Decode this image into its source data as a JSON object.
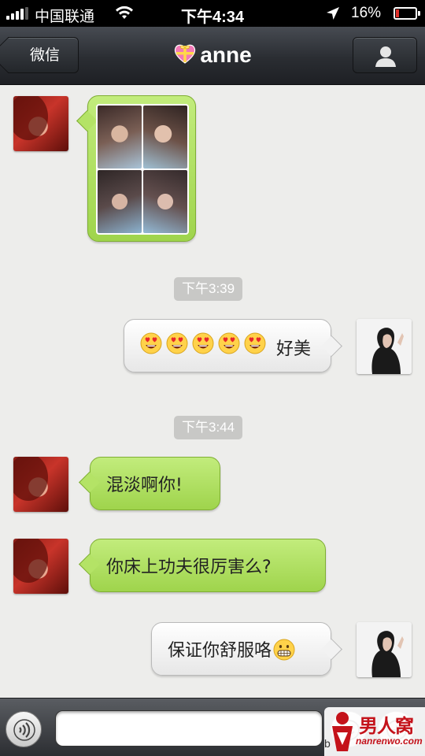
{
  "status_bar": {
    "carrier": "中国联通",
    "time": "下午4:34",
    "battery": "16%",
    "battery_level": 0.16,
    "icons": [
      "signal-icon",
      "wifi-icon",
      "location-arrow-icon",
      "battery-icon"
    ]
  },
  "nav": {
    "back_label": "微信",
    "title": "anne",
    "title_icon": "gift-heart-icon",
    "contact_icon": "person-icon"
  },
  "messages": [
    {
      "from": "them",
      "type": "image",
      "content": "photo-collage"
    },
    {
      "type": "timestamp",
      "text": "下午3:39"
    },
    {
      "from": "me",
      "type": "text",
      "emoji": [
        "heart-eyes-emoji",
        "heart-eyes-emoji",
        "heart-eyes-emoji",
        "heart-eyes-emoji",
        "heart-eyes-emoji"
      ],
      "text": "好美"
    },
    {
      "type": "timestamp",
      "text": "下午3:44"
    },
    {
      "from": "them",
      "type": "text",
      "text": "混淡啊你!"
    },
    {
      "from": "them",
      "type": "text",
      "text": "你床上功夫很厉害么?"
    },
    {
      "from": "me",
      "type": "text",
      "text": "保证你舒服咯",
      "emoji": [
        "grimace-emoji"
      ]
    }
  ],
  "input": {
    "value": "",
    "placeholder": "",
    "icons": [
      "voice-icon",
      "emoji-icon",
      "add-icon"
    ]
  },
  "watermark": {
    "brand": "男人窝",
    "url": "nanrenwo.com",
    "prefix": "b"
  },
  "colors": {
    "green_bubble": "#b4e366",
    "white_bubble": "#f2f2f2",
    "nav": "#2a2d32",
    "battery_low": "#e0312b",
    "watermark": "#c4121a"
  }
}
